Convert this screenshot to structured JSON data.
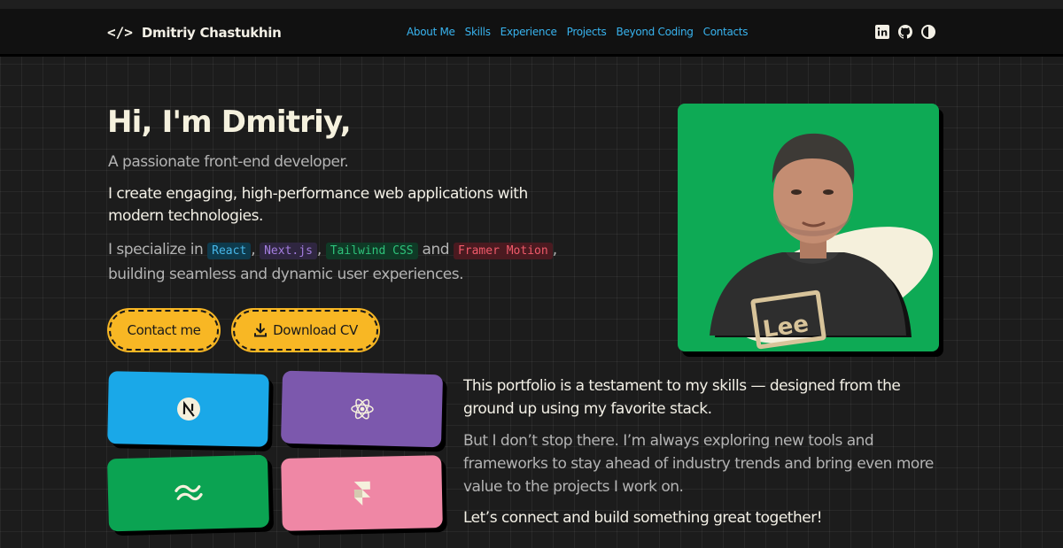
{
  "header": {
    "logo_code": "</>",
    "logo_name": "Dmitriy Chastukhin",
    "nav": [
      "About Me",
      "Skills",
      "Experience",
      "Projects",
      "Beyond Coding",
      "Contacts"
    ],
    "icons": [
      "linkedin-icon",
      "github-icon",
      "theme-toggle-icon"
    ]
  },
  "hero": {
    "title": "Hi, I'm Dmitriy,",
    "subtitle": "A passionate front-end developer.",
    "intro": "I create engaging, high-performance web applications with modern technologies.",
    "specialize_prefix": "I specialize in",
    "tags": [
      "React",
      "Next.js",
      "Tailwind CSS",
      "Framer Motion"
    ],
    "sep": ",",
    "and": "and",
    "specialize_suffix": "building seamless and dynamic user experiences.",
    "contact_button": "Contact me",
    "cv_button": "Download CV"
  },
  "tiles": [
    {
      "name": "nextjs",
      "icon": "nextjs-icon",
      "color": "#1aa8e8"
    },
    {
      "name": "react",
      "icon": "react-icon",
      "color": "#7c58ad"
    },
    {
      "name": "tailwind",
      "icon": "tailwind-icon",
      "color": "#0ba352"
    },
    {
      "name": "framer",
      "icon": "framer-icon",
      "color": "#ef87a5"
    }
  ],
  "about": {
    "p1": "This portfolio is a testament to my skills — designed from the ground up using my favorite stack.",
    "p2": "But I don’t stop there. I’m always exploring new tools and frameworks to stay ahead of industry trends and bring even more value to the projects I work on.",
    "p3": "Let’s connect and build something great together!"
  },
  "colors": {
    "accent": "#38b3ee",
    "button": "#f8b724",
    "photo_bg": "#0eaa55"
  }
}
